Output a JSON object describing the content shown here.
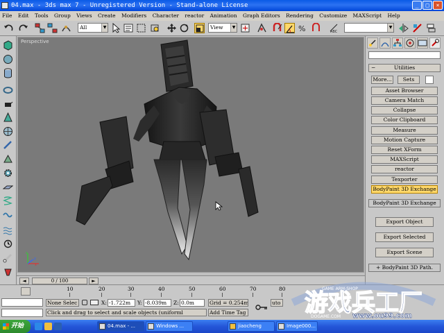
{
  "window": {
    "title": "04.max  - 3ds max 7  - Unregistered Version  - Stand-alone License"
  },
  "menu": [
    "File",
    "Edit",
    "Tools",
    "Group",
    "Views",
    "Create",
    "Modifiers",
    "Character",
    "reactor",
    "Animation",
    "Graph Editors",
    "Rendering",
    "Customize",
    "MAXScript",
    "Help"
  ],
  "toolbar": {
    "selection_filter": "All",
    "reference_coord": "View",
    "named_selection": ""
  },
  "viewport": {
    "label": "Perspective"
  },
  "command_panel": {
    "rollout_title": "Utilities",
    "more_label": "More...",
    "sets_label": "Sets",
    "utilities": [
      "Asset Browser",
      "Camera Match",
      "Collapse",
      "Color Clipboard",
      "Measure",
      "Motion Capture",
      "Reset XForm",
      "MAXScript",
      "reactor",
      "Texporter",
      "BodyPaint 3D Exchange"
    ],
    "selected_utility": "BodyPaint 3D Exchange",
    "exchange_button": "BodyPaint 3D Exchange",
    "export_object": "Export Object",
    "export_selected": "Export Selected",
    "export_scene": "Export Scene",
    "path_rollout": "+ BodyPaint 3D Path."
  },
  "timeline": {
    "slider_label": "0 / 100",
    "ticks": [
      "10",
      "20",
      "30",
      "40",
      "50",
      "60",
      "70",
      "80"
    ]
  },
  "status": {
    "selection": "None Selec",
    "x_label": "X:",
    "x_value": "-1.722m",
    "y_label": "Y:",
    "y_value": "-8.039m",
    "z_label": "Z:",
    "z_value": "0.0m",
    "grid": "Grid = 0.254m",
    "prompt": "Click and drag to select and scale objects (uniforml",
    "add_time_tag": "Add Time Tag",
    "auto_key": "uto K"
  },
  "watermark": {
    "text": "游戏兵工厂",
    "url": "www.ou99.com",
    "arc_text": "GAME ARM-SHOP",
    "sub_text": "DOGAME.COM"
  },
  "taskbar": {
    "start": "开始",
    "items": [
      {
        "label": "04.max - ...",
        "active": true
      },
      {
        "label": "Windows ...",
        "active": false
      },
      {
        "label": "jiaocheng",
        "active": false
      },
      {
        "label": "Image000...",
        "active": false
      }
    ]
  }
}
